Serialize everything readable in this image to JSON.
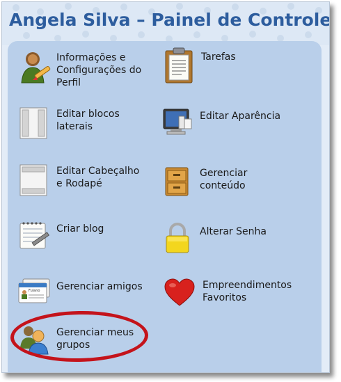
{
  "header": {
    "title": "Angela Silva – Painel de Controle"
  },
  "items": [
    {
      "label_lines": [
        "Informações e",
        "Configurações do",
        "Perfil"
      ],
      "icon": "profile-user-pencil-icon"
    },
    {
      "label_lines": [
        "Tarefas"
      ],
      "icon": "clipboard-icon"
    },
    {
      "label_lines": [
        "Editar blocos",
        "laterais"
      ],
      "icon": "sidebar-blocks-icon"
    },
    {
      "label_lines": [
        "Editar Aparência"
      ],
      "icon": "monitor-paintbrush-icon"
    },
    {
      "label_lines": [
        "Editar Cabeçalho",
        "e Rodapé"
      ],
      "icon": "header-footer-icon"
    },
    {
      "label_lines": [
        "Gerenciar",
        "conteúdo"
      ],
      "icon": "filing-cabinet-icon"
    },
    {
      "label_lines": [
        "Criar blog"
      ],
      "icon": "notepad-pencil-icon"
    },
    {
      "label_lines": [
        "Alterar Senha"
      ],
      "icon": "padlock-icon"
    },
    {
      "label_lines": [
        "Gerenciar amigos"
      ],
      "icon": "id-cards-icon"
    },
    {
      "label_lines": [
        "Empreendimentos",
        "Favoritos"
      ],
      "icon": "heart-icon"
    },
    {
      "label_lines": [
        "Gerenciar meus",
        "grupos"
      ],
      "icon": "group-users-icon"
    }
  ],
  "id_card_text": "Fulano",
  "colors": {
    "title": "#2d5d9e",
    "panel": "#b9cfea",
    "highlight_oval": "#c4131b"
  }
}
